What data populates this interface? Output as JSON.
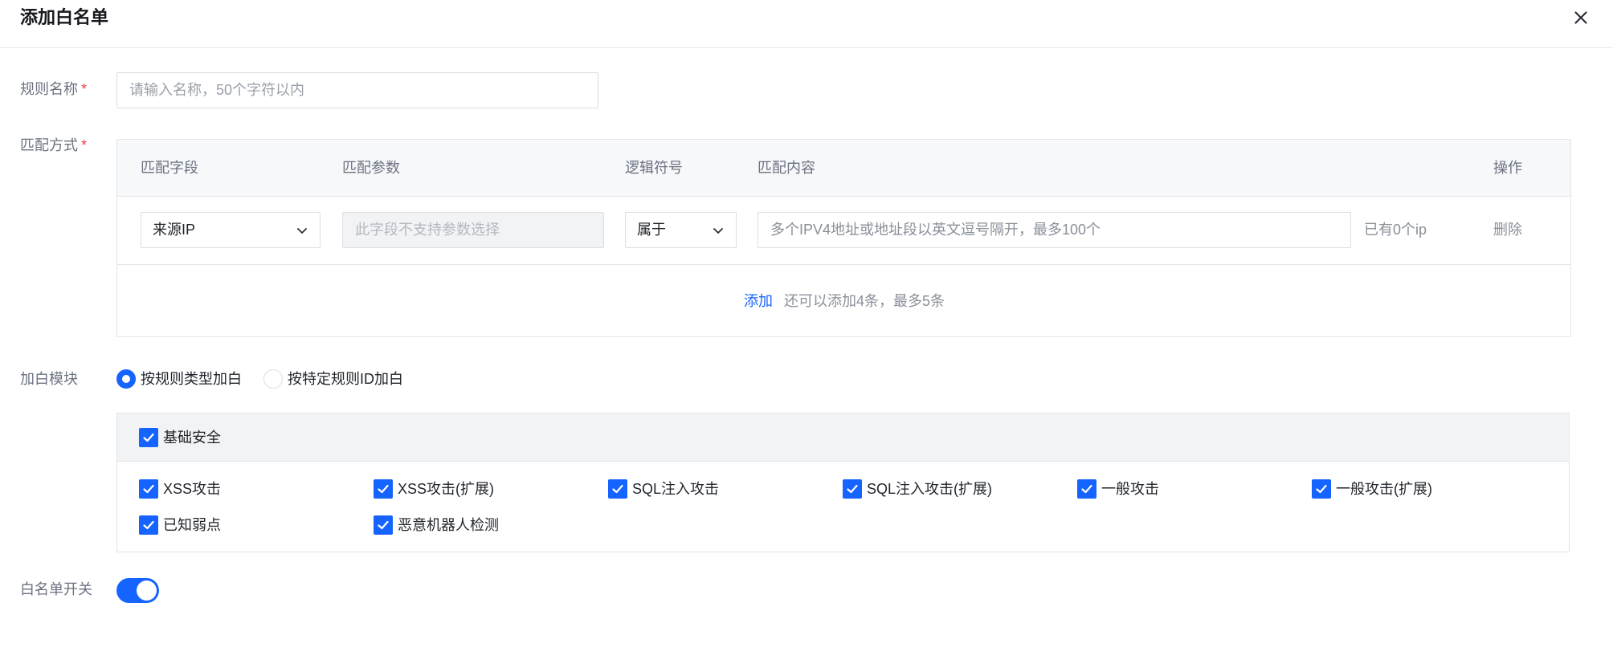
{
  "dialog": {
    "title": "添加白名单",
    "close_icon": "close-icon"
  },
  "rule_name": {
    "label": "规则名称",
    "required_mark": "*",
    "placeholder": "请输入名称，50个字符以内",
    "value": ""
  },
  "match": {
    "label": "匹配方式",
    "required_mark": "*",
    "headers": {
      "field": "匹配字段",
      "param": "匹配参数",
      "logic": "逻辑符号",
      "content": "匹配内容",
      "action": "操作"
    },
    "rows": [
      {
        "field": "来源IP",
        "param_placeholder": "此字段不支持参数选择",
        "logic": "属于",
        "content_placeholder": "多个IPV4地址或地址段以英文逗号隔开，最多100个",
        "ip_count": "已有0个ip",
        "delete_label": "删除"
      }
    ],
    "add_label": "添加",
    "add_hint": "还可以添加4条，最多5条"
  },
  "module": {
    "label": "加白模块",
    "options": [
      {
        "label": "按规则类型加白",
        "selected": true
      },
      {
        "label": "按特定规则ID加白",
        "selected": false
      }
    ],
    "group": {
      "label": "基础安全",
      "checked": true,
      "items": [
        {
          "label": "XSS攻击",
          "checked": true
        },
        {
          "label": "XSS攻击(扩展)",
          "checked": true
        },
        {
          "label": "SQL注入攻击",
          "checked": true
        },
        {
          "label": "SQL注入攻击(扩展)",
          "checked": true
        },
        {
          "label": "一般攻击",
          "checked": true
        },
        {
          "label": "一般攻击(扩展)",
          "checked": true
        },
        {
          "label": "已知弱点",
          "checked": true
        },
        {
          "label": "恶意机器人检测",
          "checked": true
        }
      ]
    }
  },
  "whitelist_switch": {
    "label": "白名单开关",
    "on": true
  },
  "colors": {
    "primary": "#1664ff",
    "required": "#e54545"
  }
}
